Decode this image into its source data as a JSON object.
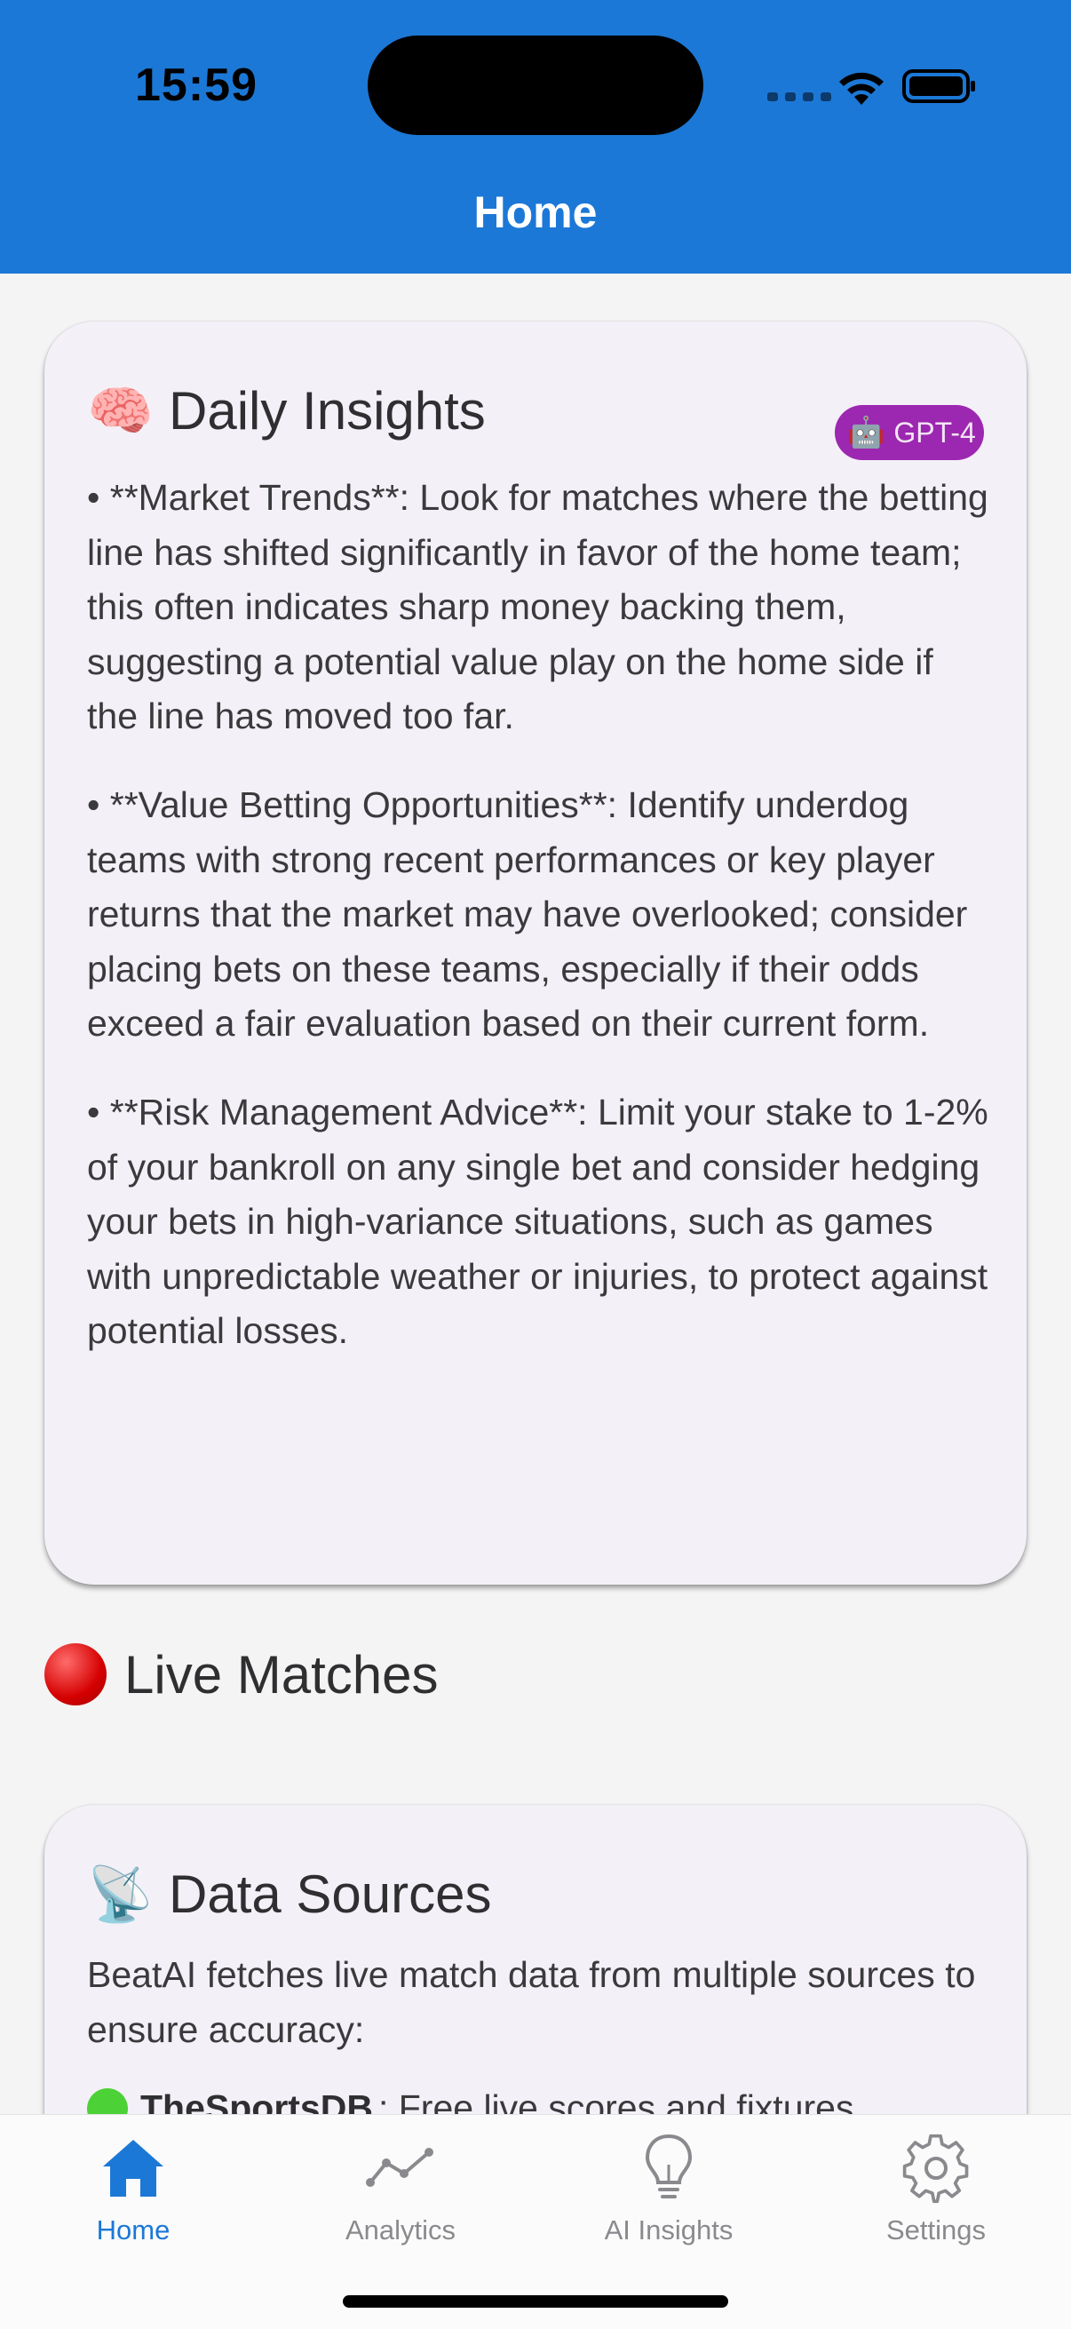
{
  "status_bar": {
    "time": "15:59"
  },
  "header": {
    "title": "Home"
  },
  "insights_card": {
    "emoji": "🧠",
    "title": "Daily Insights",
    "badge_icon": "🤖",
    "badge_label": "GPT-4",
    "items": [
      "• **Market Trends**: Look for matches where the betting line has shifted significantly in favor of the home team; this often indicates sharp money backing them, suggesting a potential value play on the home side if the line has moved too far.",
      "• **Value Betting Opportunities**: Identify underdog teams with strong recent performances or key player returns that the market may have overlooked; consider placing bets on these teams, especially if their odds exceed a fair evaluation based on their current form.",
      "• **Risk Management Advice**: Limit your stake to 1-2% of your bankroll on any single bet and consider hedging your bets in high-variance situations, such as games with unpredictable weather or injuries, to protect against potential losses."
    ]
  },
  "live_matches": {
    "title": "Live Matches"
  },
  "sources_card": {
    "emoji": "📡",
    "title": "Data Sources",
    "description": "BeatAI fetches live match data from multiple sources to ensure accuracy:",
    "first_source_name": "TheSportsDB",
    "first_source_desc": ": Free live scores and fixtures"
  },
  "tabs": [
    {
      "label": "Home",
      "icon": "home-icon",
      "active": true
    },
    {
      "label": "Analytics",
      "icon": "analytics-icon",
      "active": false
    },
    {
      "label": "AI Insights",
      "icon": "lightbulb-icon",
      "active": false
    },
    {
      "label": "Settings",
      "icon": "gear-icon",
      "active": false
    }
  ],
  "colors": {
    "accent": "#1c78d6",
    "badge": "#9c27b0",
    "card_bg": "#f4f0f7"
  }
}
